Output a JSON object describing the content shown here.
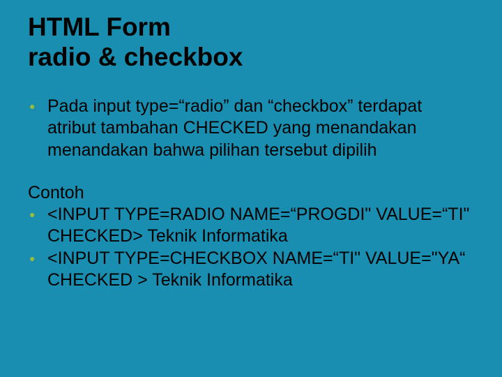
{
  "title_line1": "HTML Form",
  "title_line2": "radio & checkbox",
  "para1": "Pada input type=“radio” dan “checkbox” terdapat atribut tambahan CHECKED yang menandakan menandakan bahwa pilihan tersebut dipilih",
  "contoh_label": "Contoh",
  "item1": "<INPUT TYPE=RADIO NAME=“PROGDI\" VALUE=“TI\" CHECKED> Teknik Informatika",
  "item2": "<INPUT TYPE=CHECKBOX NAME=“TI\" VALUE=\"YA“ CHECKED > Teknik Informatika"
}
